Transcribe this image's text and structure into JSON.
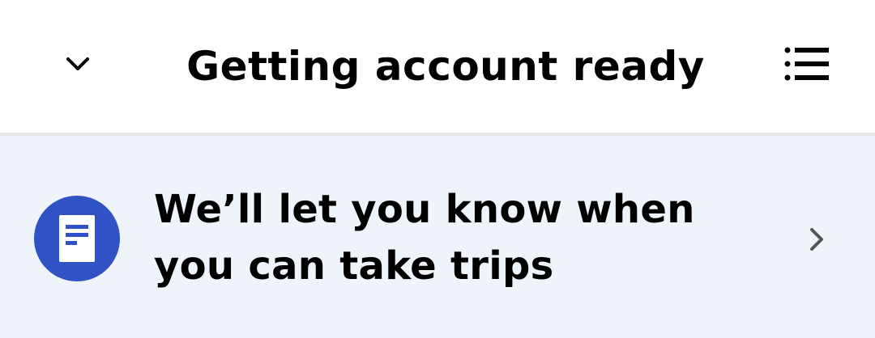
{
  "header": {
    "title": "Getting account ready",
    "collapse_icon": "chevron-down-icon",
    "list_icon": "list-icon"
  },
  "notice": {
    "icon": "document-icon",
    "text": "We’ll let you know when you can take trips",
    "chevron_icon": "chevron-right-icon"
  },
  "colors": {
    "accent": "#3152c4",
    "notice_bg": "#eff4fb",
    "divider": "#e6e6e6"
  }
}
